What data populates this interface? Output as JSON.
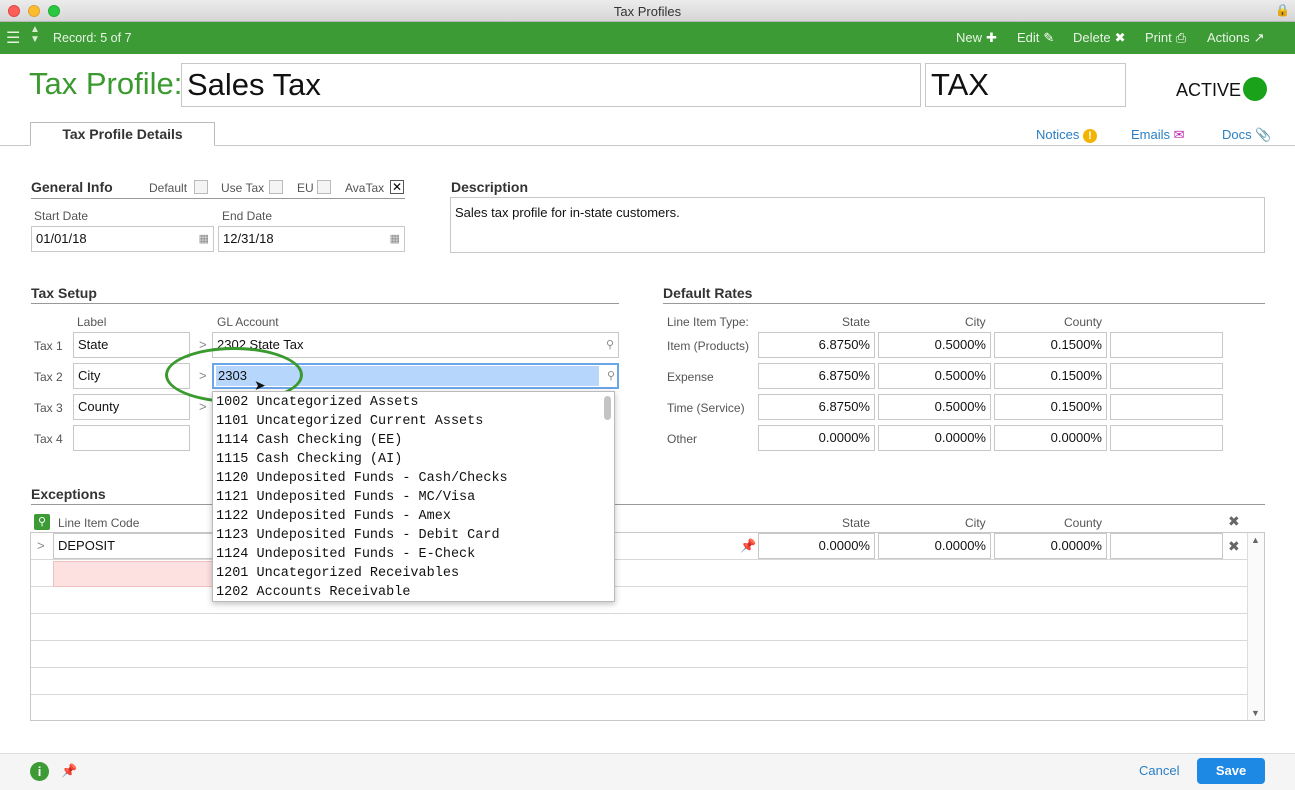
{
  "window": {
    "title": "Tax Profiles"
  },
  "toolbar": {
    "record": "Record: 5 of 7",
    "new": "New",
    "edit": "Edit",
    "delete": "Delete",
    "print": "Print",
    "actions": "Actions"
  },
  "header": {
    "label": "Tax Profile:",
    "name": "Sales Tax",
    "code": "TAX",
    "status": "ACTIVE"
  },
  "tabs": {
    "details": "Tax Profile Details",
    "notices": "Notices",
    "emails": "Emails",
    "docs": "Docs"
  },
  "general": {
    "title": "General Info",
    "default": "Default",
    "use_tax": "Use Tax",
    "eu": "EU",
    "avatax": "AvaTax",
    "avatax_mark": "✕",
    "start_label": "Start Date",
    "start": "01/01/18",
    "end_label": "End Date",
    "end": "12/31/18"
  },
  "description": {
    "title": "Description",
    "text": "Sales tax profile for in-state customers."
  },
  "tax_setup": {
    "title": "Tax Setup",
    "label_col": "Label",
    "gl_col": "GL Account",
    "rows": [
      {
        "name": "Tax 1",
        "label": "State",
        "gl": "2302 State Tax"
      },
      {
        "name": "Tax 2",
        "label": "City",
        "gl": "2303"
      },
      {
        "name": "Tax 3",
        "label": "County",
        "gl": ""
      },
      {
        "name": "Tax 4",
        "label": "",
        "gl": ""
      }
    ]
  },
  "dropdown": {
    "items": [
      "1002 Uncategorized Assets",
      "1101 Uncategorized Current Assets",
      "1114 Cash Checking (EE)",
      "1115 Cash Checking (AI)",
      "1120 Undeposited Funds - Cash/Checks",
      "1121 Undeposited Funds - MC/Visa",
      "1122 Undeposited Funds - Amex",
      "1123 Undeposited Funds - Debit Card",
      "1124 Undeposited Funds - E-Check",
      "1201 Uncategorized Receivables",
      "1202 Accounts Receivable"
    ]
  },
  "rates": {
    "title": "Default Rates",
    "type_col": "Line Item Type:",
    "state_col": "State",
    "city_col": "City",
    "county_col": "County",
    "rows": [
      {
        "type": "Item (Products)",
        "state": "6.8750%",
        "city": "0.5000%",
        "county": "0.1500%"
      },
      {
        "type": "Expense",
        "state": "6.8750%",
        "city": "0.5000%",
        "county": "0.1500%"
      },
      {
        "type": "Time (Service)",
        "state": "6.8750%",
        "city": "0.5000%",
        "county": "0.1500%"
      },
      {
        "type": "Other",
        "state": "0.0000%",
        "city": "0.0000%",
        "county": "0.0000%"
      }
    ]
  },
  "exceptions": {
    "title": "Exceptions",
    "code_col": "Line Item Code",
    "state_col": "State",
    "city_col": "City",
    "county_col": "County",
    "row": {
      "code": "DEPOSIT",
      "state": "0.0000%",
      "city": "0.0000%",
      "county": "0.0000%"
    }
  },
  "footer": {
    "cancel": "Cancel",
    "save": "Save"
  },
  "colors": {
    "green": "#3d9b35",
    "title_green": "#3a9a2f",
    "active": "#1aa21a",
    "link": "#2a7fc4",
    "save": "#1e88e5"
  }
}
